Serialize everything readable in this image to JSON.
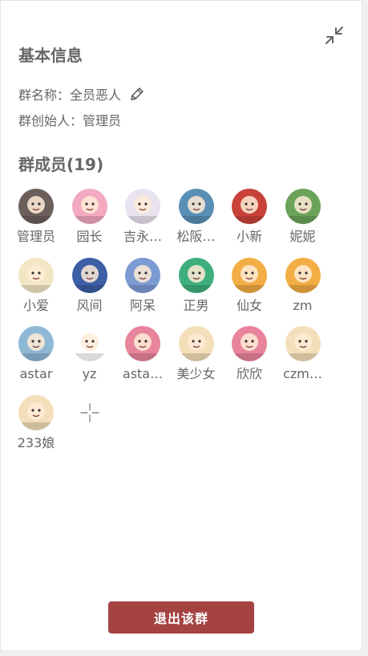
{
  "basic_info": {
    "title": "基本信息",
    "group_name_label": "群名称：",
    "group_name": "全员恶人",
    "creator_label": "群创始人：",
    "creator": "管理员"
  },
  "members_section": {
    "title": "群成员(19)",
    "members": [
      {
        "name": "管理员",
        "color": "#6b5f5c"
      },
      {
        "name": "园长",
        "color": "#f3a9c0"
      },
      {
        "name": "吉永…",
        "color": "#e9e3ef"
      },
      {
        "name": "松阪…",
        "color": "#5a8fb5"
      },
      {
        "name": "小新",
        "color": "#c9423a"
      },
      {
        "name": "妮妮",
        "color": "#6ba35a"
      },
      {
        "name": "小爱",
        "color": "#f2e6c4"
      },
      {
        "name": "风间",
        "color": "#3c5fa6"
      },
      {
        "name": "阿呆",
        "color": "#7c9bd3"
      },
      {
        "name": "正男",
        "color": "#3fae7e"
      },
      {
        "name": "仙女",
        "color": "#f2ad45"
      },
      {
        "name": "zm",
        "color": "#f2ad45"
      },
      {
        "name": "astar",
        "color": "#8fb8d6"
      },
      {
        "name": "yz",
        "color": "#ffffff"
      },
      {
        "name": "asta…",
        "color": "#e8849c"
      },
      {
        "name": "美少女",
        "color": "#f3dfb9"
      },
      {
        "name": "欣欣",
        "color": "#e8849c"
      },
      {
        "name": "czm…",
        "color": "#f3dfb9"
      },
      {
        "name": "233娘",
        "color": "#f3dfb9"
      }
    ]
  },
  "actions": {
    "quit_label": "退出该群"
  },
  "colors": {
    "quit_button": "#a54343",
    "text": "#666666"
  },
  "icons": {
    "collapse": "collapse-arrows-icon",
    "edit": "pencil-icon",
    "add": "plus-icon"
  }
}
